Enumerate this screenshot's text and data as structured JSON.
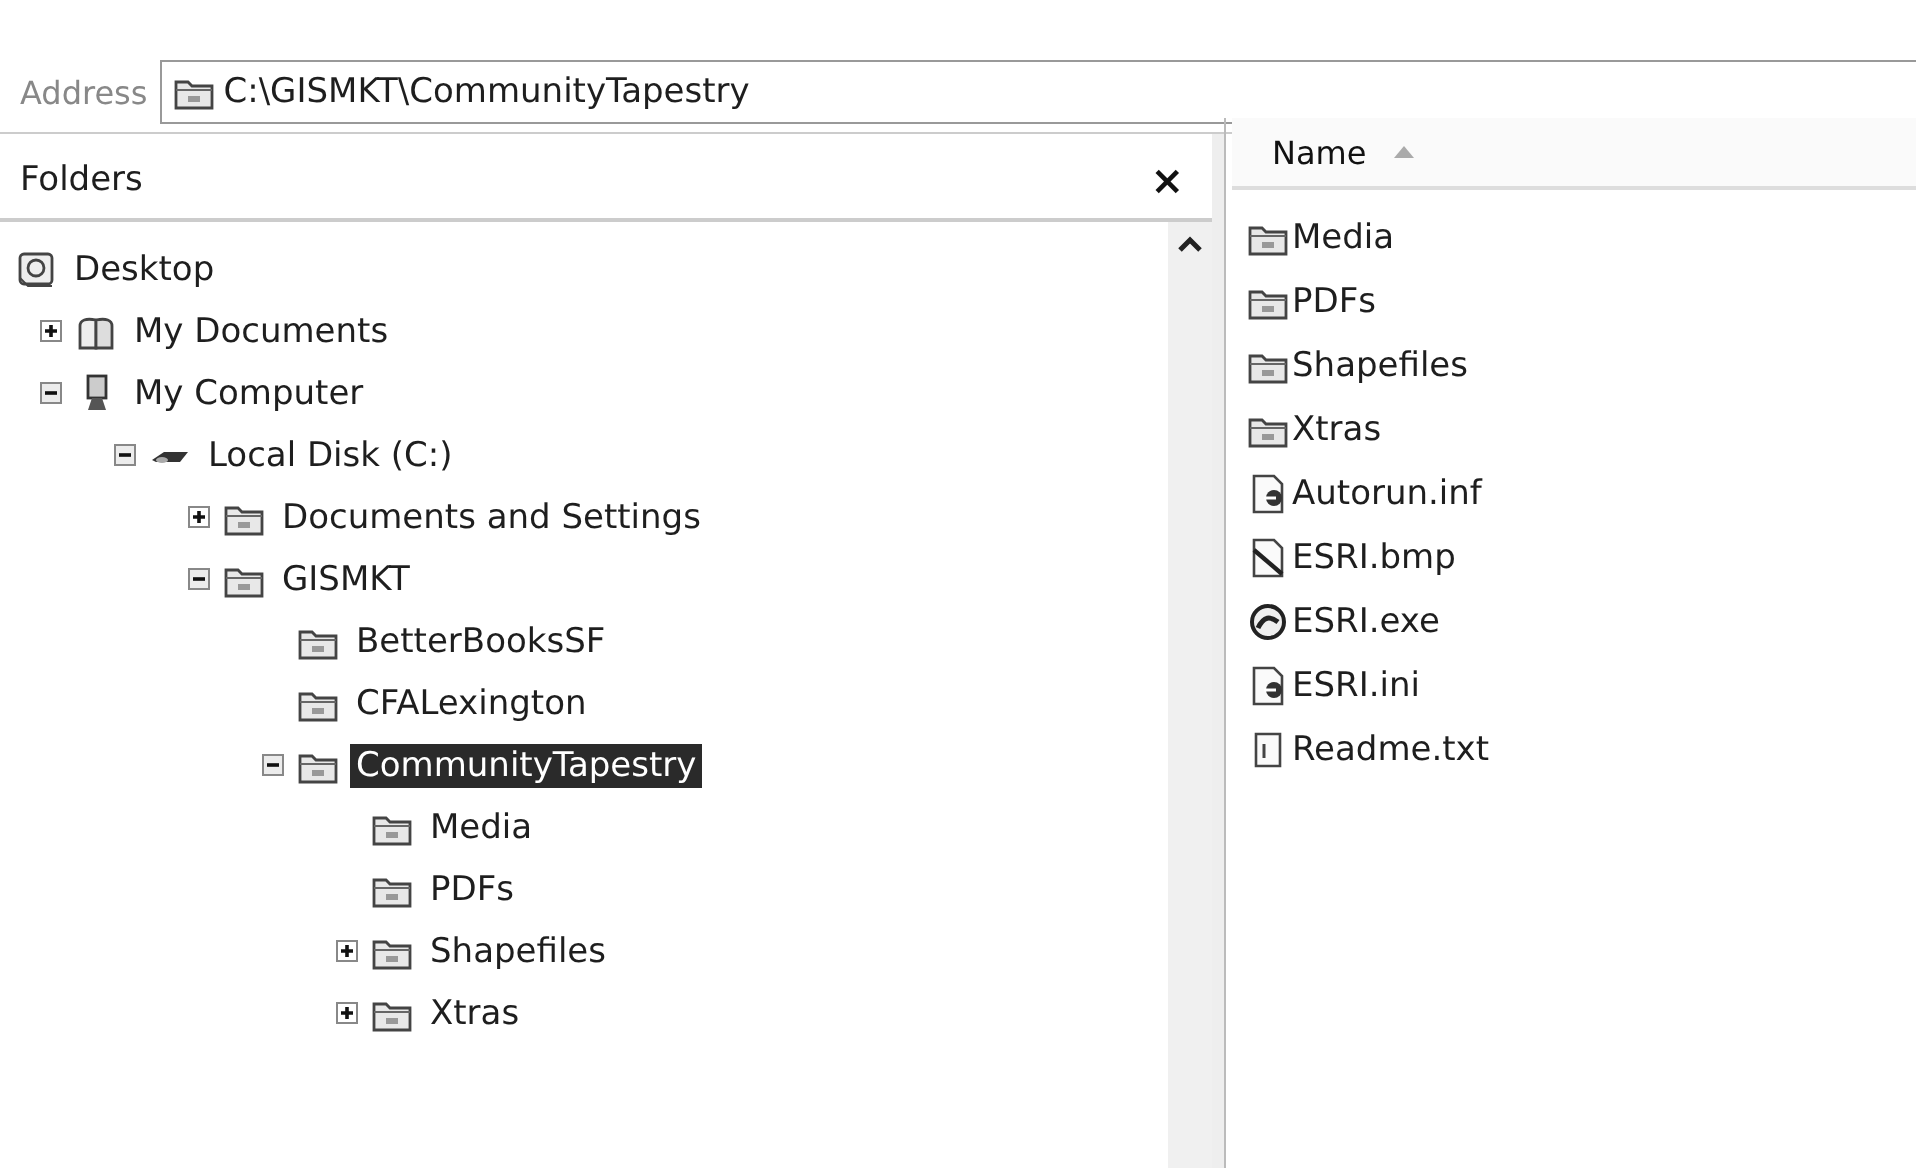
{
  "address_bar": {
    "label": "Address",
    "value": "C:\\GISMKT\\CommunityTapestry"
  },
  "folders_pane": {
    "title": "Folders",
    "close": "×",
    "tree": [
      {
        "label": "Desktop",
        "kind": "desktop",
        "expandable": false,
        "selected": false,
        "children": [
          {
            "label": "My Documents",
            "kind": "documents",
            "expandable": true,
            "expanded": false,
            "selected": false
          },
          {
            "label": "My Computer",
            "kind": "computer",
            "expandable": true,
            "expanded": true,
            "selected": false,
            "children": [
              {
                "label": "Local Disk (C:)",
                "kind": "disk",
                "expandable": true,
                "expanded": true,
                "selected": false,
                "children": [
                  {
                    "label": "Documents and Settings",
                    "kind": "folder",
                    "expandable": true,
                    "expanded": false,
                    "selected": false
                  },
                  {
                    "label": "GISMKT",
                    "kind": "folder",
                    "expandable": true,
                    "expanded": true,
                    "selected": false,
                    "children": [
                      {
                        "label": "BetterBooksSF",
                        "kind": "folder",
                        "expandable": false,
                        "selected": false
                      },
                      {
                        "label": "CFALexington",
                        "kind": "folder",
                        "expandable": false,
                        "selected": false
                      },
                      {
                        "label": "CommunityTapestry",
                        "kind": "folder",
                        "expandable": true,
                        "expanded": true,
                        "selected": true,
                        "children": [
                          {
                            "label": "Media",
                            "kind": "folder",
                            "expandable": false,
                            "selected": false
                          },
                          {
                            "label": "PDFs",
                            "kind": "folder",
                            "expandable": false,
                            "selected": false
                          },
                          {
                            "label": "Shapefiles",
                            "kind": "folder",
                            "expandable": true,
                            "expanded": false,
                            "selected": false
                          },
                          {
                            "label": "Xtras",
                            "kind": "folder",
                            "expandable": true,
                            "expanded": false,
                            "selected": false
                          }
                        ]
                      }
                    ]
                  }
                ]
              }
            ]
          }
        ]
      }
    ]
  },
  "file_list": {
    "columns": [
      {
        "label": "Name",
        "sorted_ascending": true
      }
    ],
    "files": [
      {
        "name": "Media",
        "kind": "folder"
      },
      {
        "name": "PDFs",
        "kind": "folder"
      },
      {
        "name": "Shapefiles",
        "kind": "folder"
      },
      {
        "name": "Xtras",
        "kind": "folder"
      },
      {
        "name": "Autorun.inf",
        "kind": "setup"
      },
      {
        "name": "ESRI.bmp",
        "kind": "image"
      },
      {
        "name": "ESRI.exe",
        "kind": "app"
      },
      {
        "name": "ESRI.ini",
        "kind": "setup"
      },
      {
        "name": "Readme.txt",
        "kind": "text"
      }
    ]
  }
}
